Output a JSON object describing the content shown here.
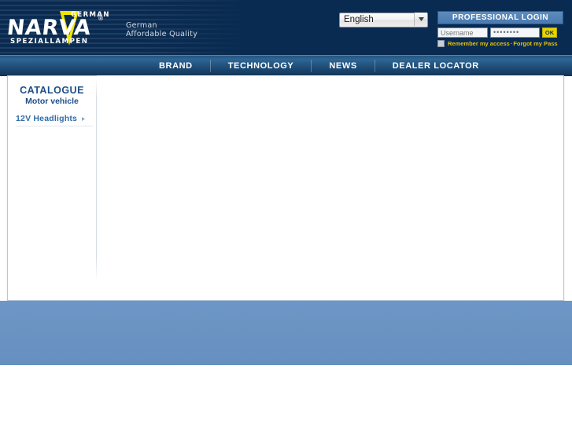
{
  "header": {
    "logo": {
      "brand": "NARVA",
      "top_text": "GERMANY",
      "bottom_text": "SPEZIALLAMPEN",
      "registered_mark": "®"
    },
    "claim_line1": "German",
    "claim_line2": "Affordable Quality",
    "language": {
      "selected": "English",
      "options": [
        "English"
      ]
    },
    "login": {
      "title": "PROFESSIONAL LOGIN",
      "username_placeholder": "Username",
      "username_value": "",
      "password_value": "••••••••",
      "ok_label": "OK",
      "remember_label": "Remember my access",
      "separator": "·",
      "forgot_label": "Forgot my Pass",
      "remember_checked": false
    }
  },
  "nav": {
    "items": [
      {
        "label": "BRAND"
      },
      {
        "label": "TECHNOLOGY"
      },
      {
        "label": "NEWS"
      },
      {
        "label": "DEALER LOCATOR"
      }
    ]
  },
  "sidebar": {
    "title": "CATALOGUE",
    "subtitle": "Motor vehicle",
    "items": [
      {
        "label": "12V Headlights"
      }
    ]
  },
  "main": {
    "content": ""
  },
  "colors": {
    "header_bg": "#0a2b51",
    "nav_bg": "#1f4d77",
    "accent_yellow": "#e8d400",
    "link_blue": "#2f6bab",
    "footer_blue": "#6a93c2",
    "login_bar": "#4a7ab0"
  }
}
